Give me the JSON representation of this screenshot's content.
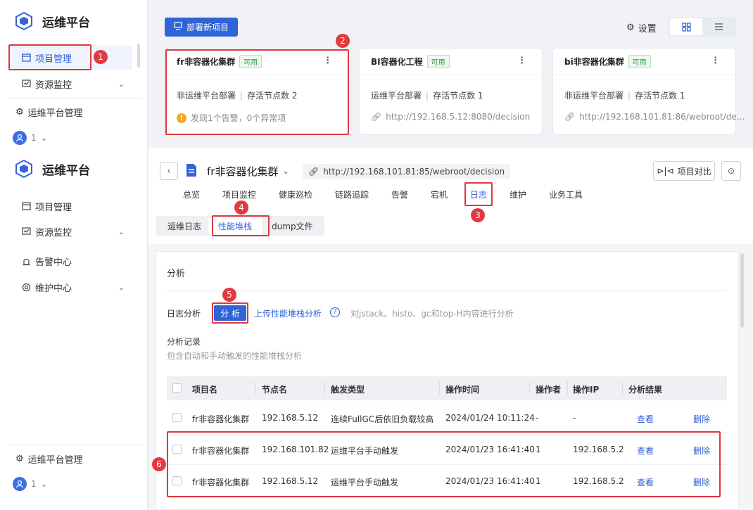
{
  "sidebar_top": {
    "logo": "运维平台",
    "items": [
      {
        "label": "项目管理",
        "icon": "project-icon"
      },
      {
        "label": "资源监控",
        "icon": "monitor-icon"
      }
    ],
    "admin": "运维平台管理",
    "user_count": "1"
  },
  "sidebar_bottom": {
    "logo": "运维平台",
    "items": [
      {
        "label": "项目管理",
        "icon": "project-icon"
      },
      {
        "label": "资源监控",
        "icon": "monitor-icon"
      },
      {
        "label": "告警中心",
        "icon": "alarm-icon"
      },
      {
        "label": "维护中心",
        "icon": "maintenance-icon"
      }
    ],
    "admin": "运维平台管理",
    "user_count": "1"
  },
  "toolbar": {
    "deploy_label": "部署新项目",
    "settings_label": "设置"
  },
  "cards": [
    {
      "title": "fr非容器化集群",
      "status": "可用",
      "deploy": "非运维平台部署",
      "nodes": "存活节点数 2",
      "extra": "发现1个告警，0个异常项",
      "extra_type": "warning"
    },
    {
      "title": "BI容器化工程",
      "status": "可用",
      "deploy": "运维平台部署",
      "nodes": "存活节点数 1",
      "extra": "http://192.168.5.12:8080/decision",
      "extra_type": "link"
    },
    {
      "title": "bi非容器化集群",
      "status": "可用",
      "deploy": "非运维平台部署",
      "nodes": "存活节点数 1",
      "extra": "http://192.168.101.81:86/webroot/de...",
      "extra_type": "link"
    }
  ],
  "detail": {
    "title": "fr非容器化集群",
    "url": "http://192.168.101.81:85/webroot/decision",
    "compare_label": "项目对比",
    "tabs": [
      "总览",
      "项目监控",
      "健康巡检",
      "链路追踪",
      "告警",
      "宕机",
      "日志",
      "维护",
      "业务工具"
    ],
    "active_tab": "日志",
    "sub_tabs": [
      "运维日志",
      "性能堆栈",
      "dump文件"
    ],
    "active_sub_tab": "性能堆栈"
  },
  "analysis": {
    "title": "分析",
    "log_label": "日志分析",
    "analyze_btn": "分 析",
    "upload_link": "上传性能堆栈分析",
    "hint": "对jstack、histo、gc和top-H内容进行分析",
    "records_title": "分析记录",
    "records_desc": "包含自动和手动触发的性能堆栈分析",
    "columns": [
      "项目名",
      "节点名",
      "触发类型",
      "操作时间",
      "操作者",
      "操作IP",
      "分析结果"
    ],
    "rows": [
      {
        "project": "fr非容器化集群",
        "node": "192.168.5.12",
        "type": "连续FullGC后依旧负载较高",
        "time": "2024/01/24 10:11:24",
        "operator": "-",
        "ip": "-",
        "view": "查看",
        "delete": "删除"
      },
      {
        "project": "fr非容器化集群",
        "node": "192.168.101.82",
        "type": "运维平台手动触发",
        "time": "2024/01/23 16:41:40",
        "operator": "1",
        "ip": "192.168.5.2",
        "view": "查看",
        "delete": "删除"
      },
      {
        "project": "fr非容器化集群",
        "node": "192.168.5.12",
        "type": "运维平台手动触发",
        "time": "2024/01/23 16:41:40",
        "operator": "1",
        "ip": "192.168.5.2",
        "view": "查看",
        "delete": "删除"
      }
    ]
  },
  "annotations": [
    "1",
    "2",
    "3",
    "4",
    "5",
    "6"
  ],
  "colors": {
    "accent": "#2f63d7",
    "highlight": "#e0383e",
    "available": "#2c9a3e"
  }
}
